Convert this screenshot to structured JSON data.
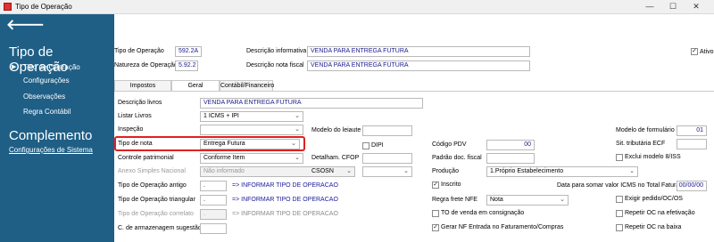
{
  "window": {
    "title": "Tipo de Operação",
    "minimize": "—",
    "maximize": "☐",
    "close": "✕"
  },
  "sidebar": {
    "back_icon": "🡐",
    "section1_title": "Tipo de Operação",
    "items": [
      "Tipo de Operação",
      "Configurações",
      "Observações",
      "Regra Contábil"
    ],
    "section2_title": "Complemento",
    "link": "Configurações de Sistema"
  },
  "header": {
    "tipo_operacao_label": "Tipo de Operação",
    "tipo_operacao_value": "592.2A",
    "natureza_label": "Natureza de Operação",
    "natureza_value": "5.92.2",
    "desc_informativa_label": "Descrição informativa",
    "desc_informativa_value": "VENDA PARA ENTREGA FUTURA",
    "desc_nota_label": "Descrição nota fiscal",
    "desc_nota_value": "VENDA PARA ENTREGA FUTURA",
    "ativo_label": "Ativo",
    "ativo_checked": "✓"
  },
  "tabs": [
    "Impostos",
    "Geral",
    "Contábil/Financeiro"
  ],
  "geral": {
    "descricao_livros_label": "Descrição livros",
    "descricao_livros_value": "VENDA PARA ENTREGA FUTURA",
    "listar_livros_label": "Listar Livros",
    "listar_livros_value": "1 ICMS + IPI",
    "inspecao_label": "Inspeção",
    "inspecao_value": "",
    "tipo_nota_label": "Tipo de nota",
    "tipo_nota_value": "Entrega Futura",
    "controle_label": "Controle patrimonial",
    "controle_value": "Conforme Item",
    "anexo_label": "Anexo Simples Nacional",
    "anexo_value": "Não informado",
    "op_antigo_label": "Tipo de Operação antigo",
    "op_antigo_value": ".",
    "op_antigo_link": "=> INFORMAR TIPO DE OPERACAO",
    "op_triangular_label": "Tipo de Operação triangular",
    "op_triangular_value": ".",
    "op_triangular_link": "=> INFORMAR TIPO DE OPERACAO",
    "op_correlato_label": "Tipo de Operação correlato",
    "op_correlato_value": ".",
    "op_correlato_link": "=> INFORMAR TIPO DE OPERACAO",
    "armazenagem_label": "C. de armazenagem sugestão",
    "armazenagem_value": "",
    "modelo_leiaute_label": "Modelo do leiaute",
    "dipi_label": "DIPI",
    "detalham_label": "Detalham. CFOP",
    "csosn_label": "CSOSN",
    "codigo_pdv_label": "Código PDV",
    "codigo_pdv_value": "00",
    "padrao_doc_label": "Padrão doc. fiscal",
    "producao_label": "Produção",
    "producao_value": "1.Próprio Estabelecimento",
    "inscrito_label": "Inscrito",
    "inscrito_checked": "✓",
    "regra_frete_label": "Regra frete NFE",
    "regra_frete_value": "Nota",
    "to_venda_label": "TO de venda em consignação",
    "gerar_nf_label": "Gerar NF Entrada no Faturamento/Compras",
    "gerar_nf_checked": "✓",
    "modelo_formulario_label": "Modelo de formulário",
    "modelo_formulario_value": "01",
    "sit_tributaria_label": "Sit. tributária ECF",
    "exclui_modelo_label": "Exclui modelo 8/ISS",
    "data_somar_label": "Data para somar valor ICMS no Total Faturado",
    "data_somar_value": "00/00/00",
    "exigir_pedido_label": "Exigir pedido/OC/OS",
    "repetir_oc_efetivacao_label": "Repetir OC na efetivação",
    "repetir_oc_baixa_label": "Repetir OC na baixa"
  }
}
